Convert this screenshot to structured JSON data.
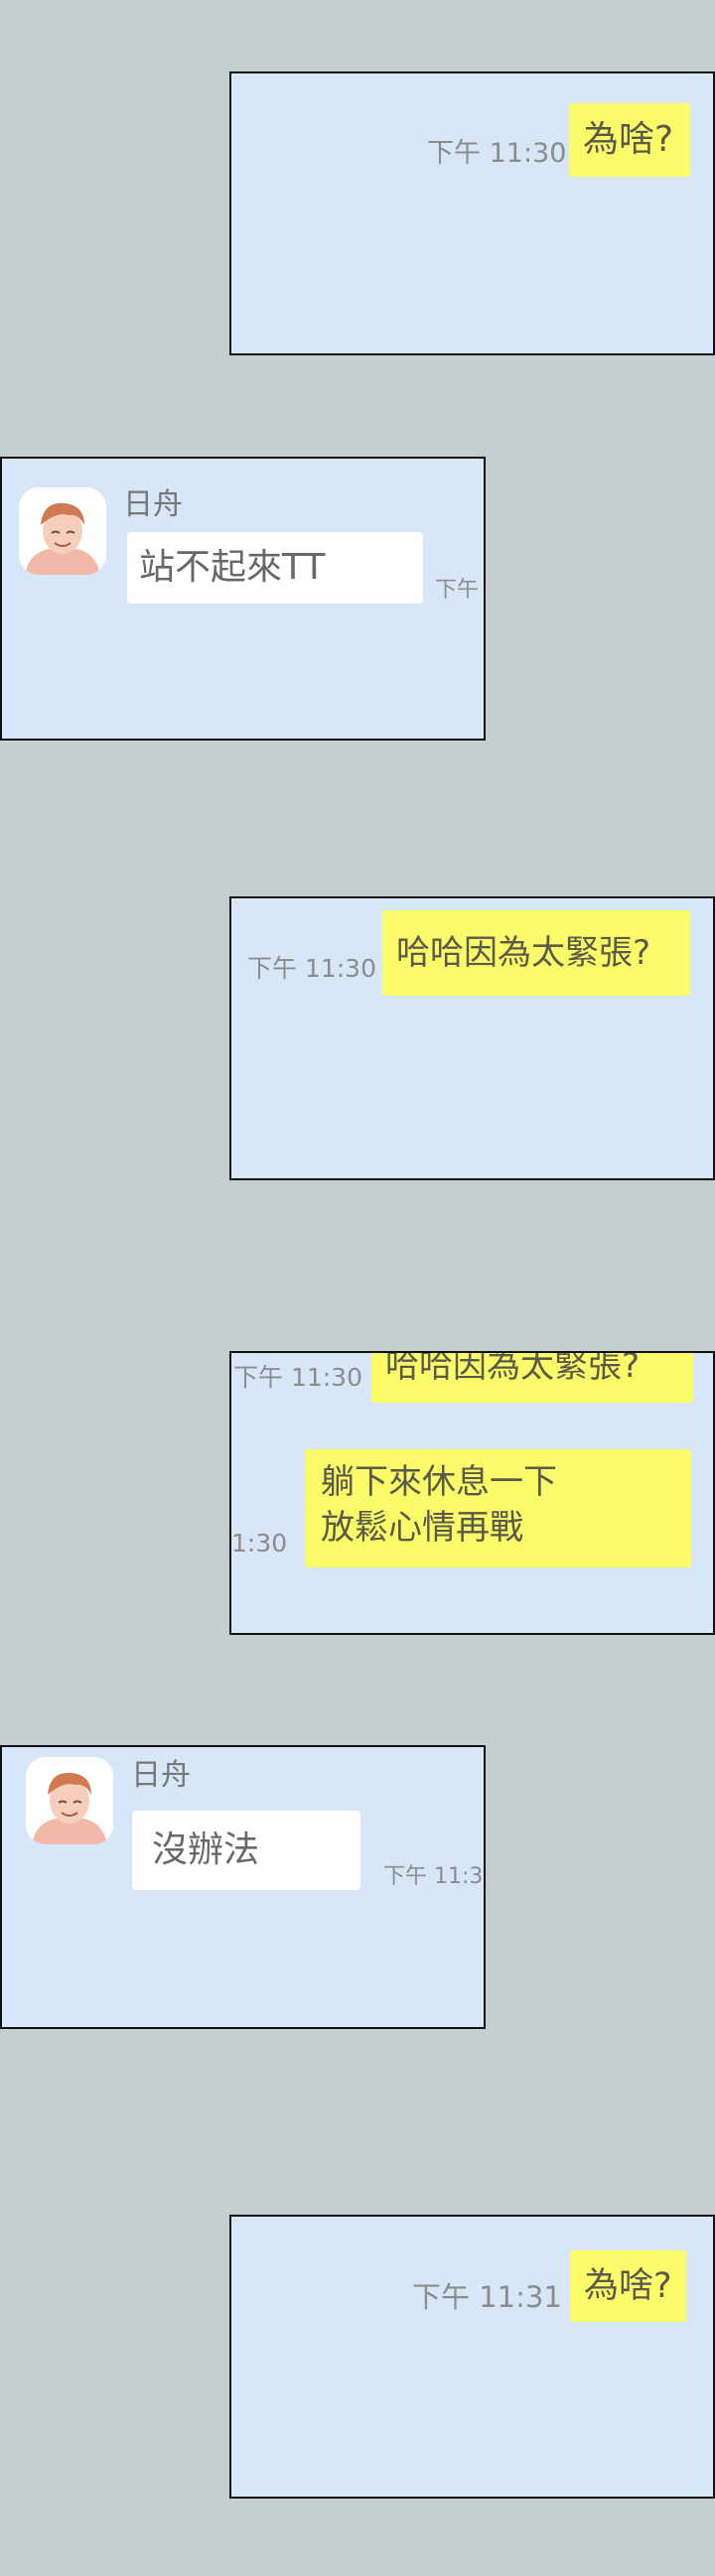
{
  "colors": {
    "background": "#c3cfd1",
    "panel": "#d8e7f7",
    "bubble_me": "#fbfb6a",
    "bubble_them": "#ffffff",
    "timestamp": "#8c8c8c"
  },
  "panels": {
    "p1": {
      "message": "為啥?",
      "time": "下午 11:30"
    },
    "p2": {
      "sender": "日舟",
      "message": "站不起來TT",
      "time": "下午"
    },
    "p3": {
      "message": "哈哈因為太緊張?",
      "time": "下午 11:30"
    },
    "p4": {
      "prev_message": "哈哈因為太緊張?",
      "prev_time": "下午 11:30",
      "message_line1": "躺下來休息一下",
      "message_line2": "放鬆心情再戰",
      "time": "1:30"
    },
    "p5": {
      "sender": "日舟",
      "message": "沒辦法",
      "time": "下午 11:3"
    },
    "p6": {
      "message": "為啥?",
      "time": "下午 11:31"
    }
  },
  "icons": {
    "avatar": "avatar-icon"
  }
}
